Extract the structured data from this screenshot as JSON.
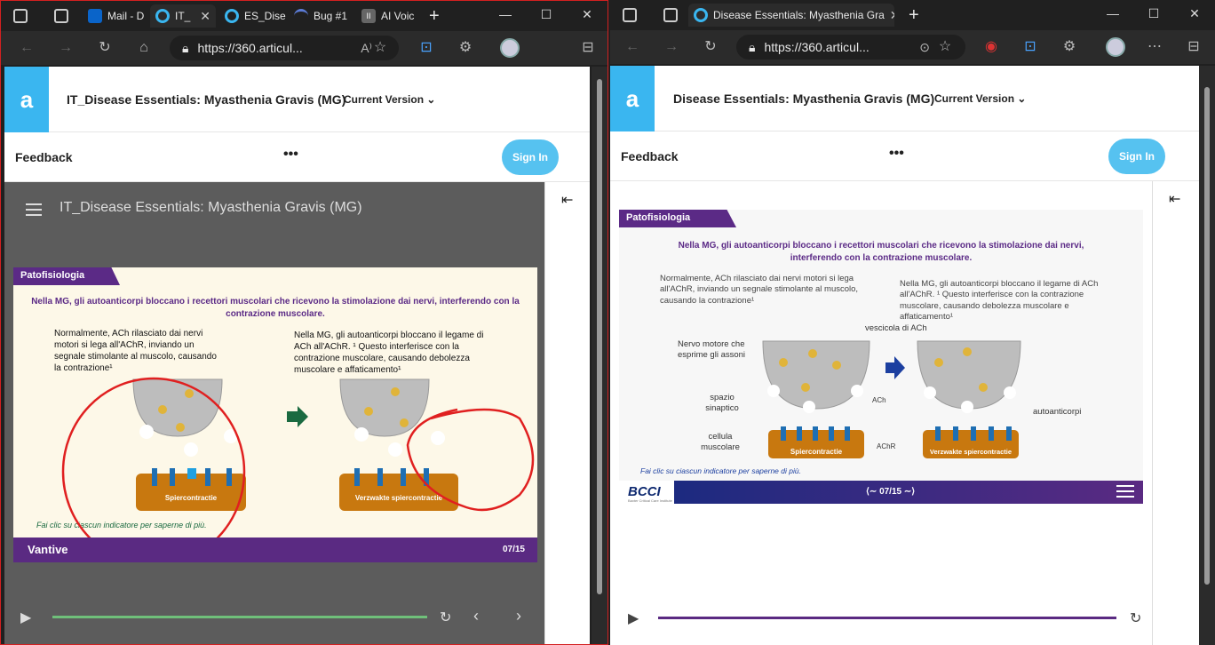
{
  "left_window": {
    "tabs": [
      {
        "label": "",
        "icon": "tab-actions-icon"
      },
      {
        "label": "",
        "icon": "tab-list-icon"
      },
      {
        "label": "Mail - D",
        "icon": "outlook-icon"
      },
      {
        "label": "IT_",
        "icon": "articulate-icon"
      },
      {
        "label": "ES_Dise",
        "icon": "articulate-icon"
      },
      {
        "label": "Bug #1",
        "icon": "bug-icon"
      },
      {
        "label": "AI Voic",
        "icon": "pause-icon"
      }
    ],
    "url": "https://360.articul...",
    "app_title": "IT_Disease Essentials: Myasthenia Gravis (MG)",
    "version_label": "Current Version",
    "feedback_label": "Feedback",
    "more_label": "•••",
    "signin_label": "Sign In",
    "player_title": "IT_Disease Essentials: Myasthenia Gravis (MG)",
    "collapse_glyph": "⇤",
    "slide": {
      "section_tag": "Patofisiologia",
      "headline": "Nella MG, gli autoanticorpi bloccano i recettori muscolari che ricevono la stimolazione dai nervi, interferendo con la contrazione muscolare.",
      "left_text": "Normalmente, ACh rilasciato dai nervi motori si lega all'AChR, inviando un segnale stimolante al muscolo, causando la contrazione¹",
      "right_text": "Nella MG, gli autoanticorpi bloccano il legame di ACh all'AChR. ¹ Questo interferisce con la contrazione muscolare, causando debolezza muscolare e affaticamento¹",
      "left_muscle_label": "Spiercontractie",
      "right_muscle_label": "Verzwakte spiercontractie",
      "hint": "Fai clic su ciascun indicatore per saperne di più.",
      "footer_brand": "Vantive",
      "page_indicator": "07/15"
    }
  },
  "right_window": {
    "tab_label": "Disease Essentials: Myasthenia Gra",
    "url": "https://360.articul...",
    "app_title": "Disease Essentials: Myasthenia Gravis (MG)",
    "version_label": "Current Version",
    "feedback_label": "Feedback",
    "more_label": "•••",
    "signin_label": "Sign In",
    "collapse_glyph": "⇤",
    "slide": {
      "section_tag": "Patofisiologia",
      "headline": "Nella MG, gli autoanticorpi bloccano i recettori muscolari che ricevono la stimolazione dai nervi, interferendo con la contrazione muscolare.",
      "left_text": "Normalmente, ACh rilasciato dai nervi motori si lega all'AChR, inviando un segnale stimolante al muscolo, causando la contrazione¹",
      "right_text": "Nella MG, gli autoanticorpi bloccano il legame di ACh all'AChR. ¹ Questo interferisce con la contrazione muscolare, causando debolezza muscolare e affaticamento¹",
      "labels": {
        "nerve": "Nervo motore che esprime gli assoni",
        "vesicle": "vescicola di ACh",
        "cleft": "spazio sinaptico",
        "ach": "ACh",
        "muscle": "cellula muscolare",
        "achr": "AChR",
        "autoantibodies": "autoanticorpi"
      },
      "left_muscle_label": "Spiercontractie",
      "right_muscle_label": "Verzwakte spiercontractie",
      "hint": "Fai clic su ciascun indicatore per saperne di più.",
      "footer_brand": "BCCI",
      "footer_sub": "Baxter Critical Care Institute",
      "page_indicator": "07/15"
    }
  }
}
